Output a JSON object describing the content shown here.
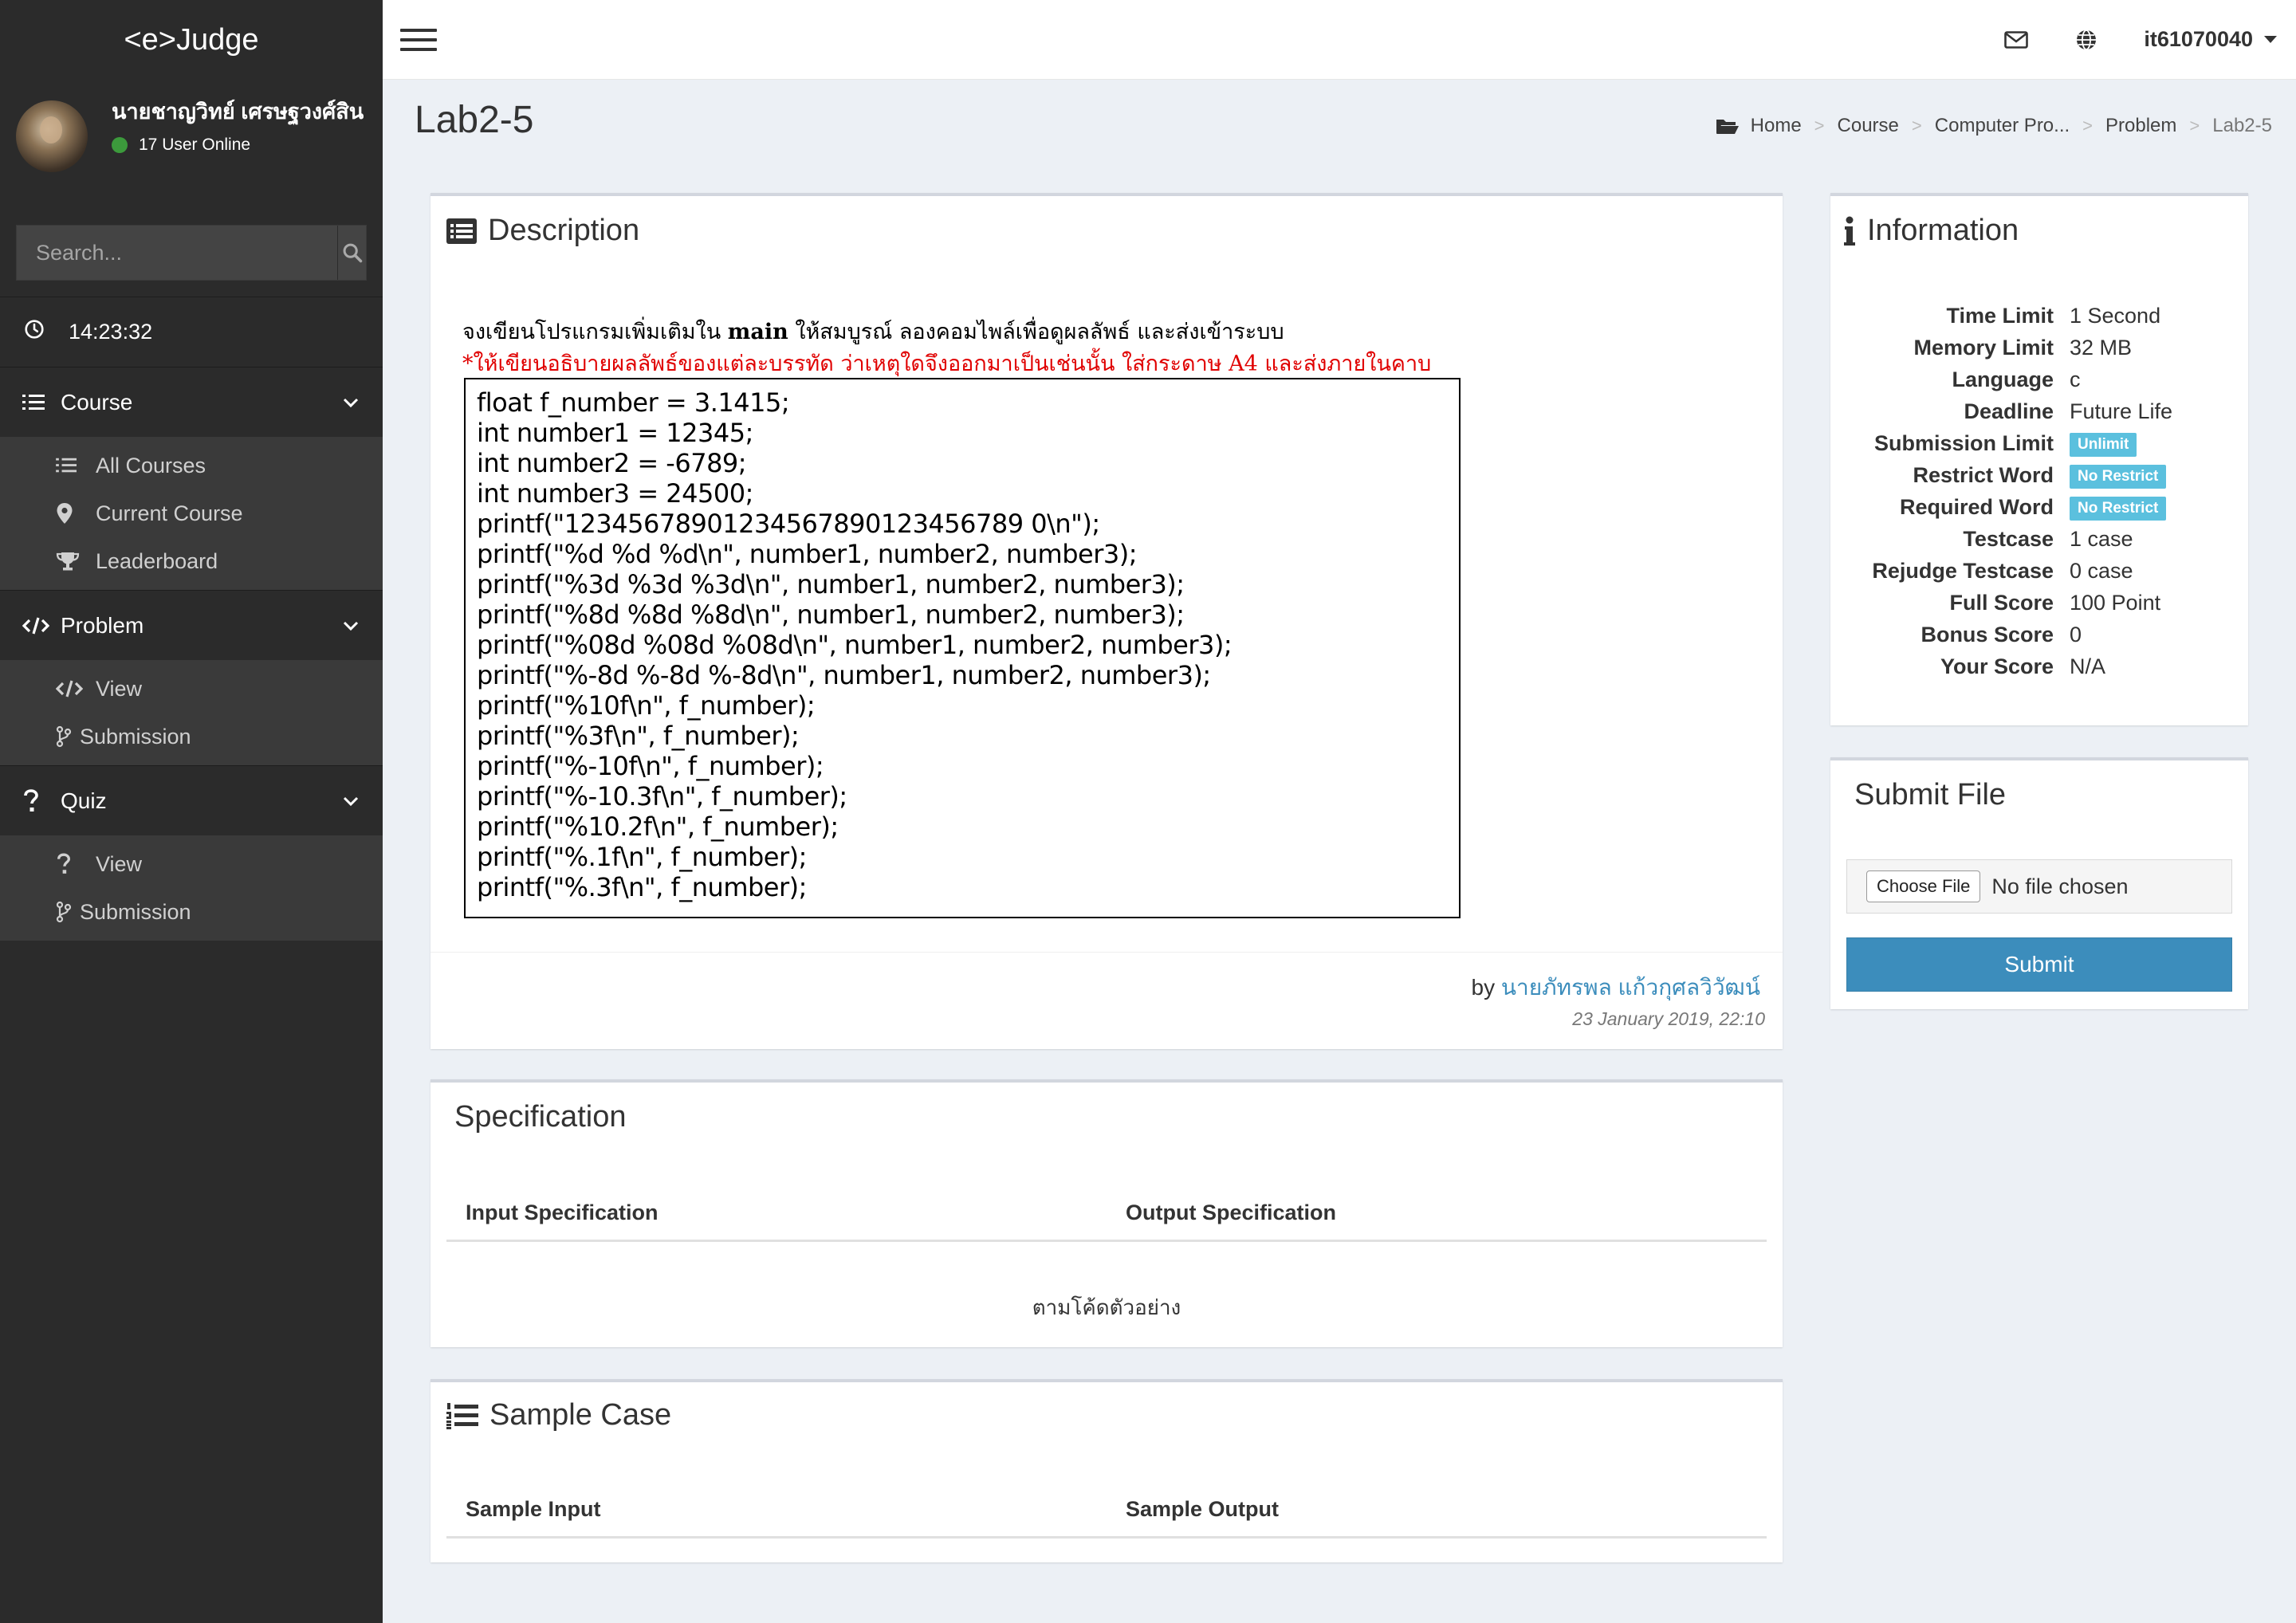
{
  "sidebar": {
    "brand": "<e>Judge",
    "user_name": "นายชาญวิทย์ เศรษฐวงศ์สิน",
    "online_text": "17 User Online",
    "search_placeholder": "Search...",
    "clock": "14:23:32",
    "menus": [
      {
        "label": "Course",
        "items": [
          "All Courses",
          "Current Course",
          "Leaderboard"
        ]
      },
      {
        "label": "Problem",
        "items": [
          "View",
          "Submission"
        ]
      },
      {
        "label": "Quiz",
        "items": [
          "View",
          "Submission"
        ]
      }
    ]
  },
  "topnav": {
    "username": "it61070040"
  },
  "header": {
    "title": "Lab2-5",
    "breadcrumb": [
      "Home",
      "Course",
      "Computer Pro...",
      "Problem",
      "Lab2-5"
    ]
  },
  "description": {
    "title": "Description",
    "line1_pre": "จงเขียนโปรแกรมเพิ่มเติมใน ",
    "line1_bold": "main",
    "line1_post": " ให้สมบูรณ์ ลองคอมไพล์เพื่อดูผลลัพธ์ และส่งเข้าระบบ",
    "line2": "*ให้เขียนอธิบายผลลัพธ์ของแต่ละบรรทัด ว่าเหตุใดจึงออกมาเป็นเช่นนั้น ใส่กระดาษ A4 และส่งภายในคาบ",
    "code": [
      "float f_number = 3.1415;",
      "int number1 = 12345;",
      "int number2 = -6789;",
      "int number3 = 24500;",
      "printf(\"12345678901234567890123456789 0\\n\");",
      "printf(\"%d %d %d\\n\", number1, number2, number3);",
      "printf(\"%3d %3d %3d\\n\", number1, number2, number3);",
      "printf(\"%8d %8d %8d\\n\", number1, number2, number3);",
      "printf(\"%08d %08d %08d\\n\", number1, number2, number3);",
      "printf(\"%-8d %-8d %-8d\\n\", number1, number2, number3);",
      "printf(\"%10f\\n\", f_number);",
      "printf(\"%3f\\n\", f_number);",
      "printf(\"%-10f\\n\", f_number);",
      "printf(\"%-10.3f\\n\", f_number);",
      "printf(\"%10.2f\\n\", f_number);",
      "printf(\"%.1f\\n\", f_number);",
      "printf(\"%.3f\\n\", f_number);"
    ],
    "by_label": "by",
    "author": "นายภัทรพล แก้วกุศลวิวัฒน์",
    "date": "23 January 2019, 22:10"
  },
  "information": {
    "title": "Information",
    "rows": [
      {
        "key": "Time Limit",
        "value": "1 Second"
      },
      {
        "key": "Memory Limit",
        "value": "32 MB"
      },
      {
        "key": "Language",
        "value": "c"
      },
      {
        "key": "Deadline",
        "value": "Future Life"
      },
      {
        "key": "Submission Limit",
        "badge": "Unlimit"
      },
      {
        "key": "Restrict Word",
        "badge": "No Restrict"
      },
      {
        "key": "Required Word",
        "badge": "No Restrict"
      },
      {
        "key": "Testcase",
        "value": "1 case"
      },
      {
        "key": "Rejudge Testcase",
        "value": "0 case"
      },
      {
        "key": "Full Score",
        "value": "100 Point"
      },
      {
        "key": "Bonus Score",
        "value": "0"
      },
      {
        "key": "Your Score",
        "value": "N/A"
      }
    ]
  },
  "submit": {
    "title": "Submit File",
    "choose_file": "Choose File",
    "no_file": "No file chosen",
    "button": "Submit"
  },
  "specification": {
    "title": "Specification",
    "input_head": "Input Specification",
    "output_head": "Output Specification",
    "body": "ตามโค้ดตัวอย่าง"
  },
  "sample": {
    "title": "Sample Case",
    "input_head": "Sample Input",
    "output_head": "Sample Output"
  },
  "colors": {
    "sidebar_bg": "#2b2b2b",
    "submenu_bg": "#3a3a3a",
    "accent": "#3c8dbc",
    "badge": "#5bc0de",
    "online": "#3c9a3c",
    "warning_text": "#e00000"
  }
}
